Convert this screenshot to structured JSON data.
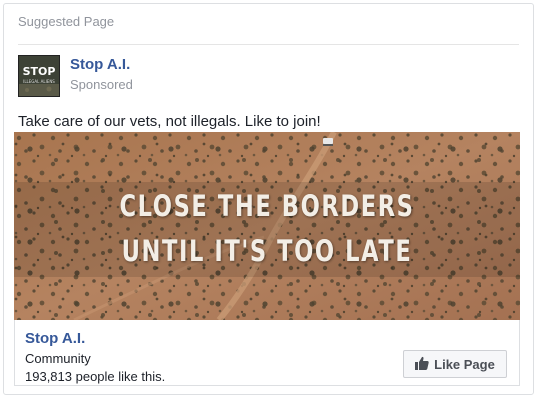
{
  "card": {
    "header": "Suggested Page"
  },
  "post": {
    "page_name": "Stop A.I.",
    "sponsored_label": "Sponsored",
    "avatar": {
      "line1": "STOP",
      "line2": "ILLEGAL ALIENS"
    },
    "text": "Take care of our vets, not illegals. Like to join!"
  },
  "ad": {
    "headline_line1": "CLOSE THE BORDERS",
    "headline_line2": "UNTIL IT'S TOO LATE",
    "footer": {
      "page_name": "Stop A.I.",
      "category": "Community",
      "likes": "193,813 people like this.",
      "like_button_label": "Like Page",
      "like_icon": "thumbs-up-icon"
    }
  },
  "colors": {
    "link_blue": "#365899",
    "muted_gray": "#90949c",
    "desert": "#b07c57"
  }
}
